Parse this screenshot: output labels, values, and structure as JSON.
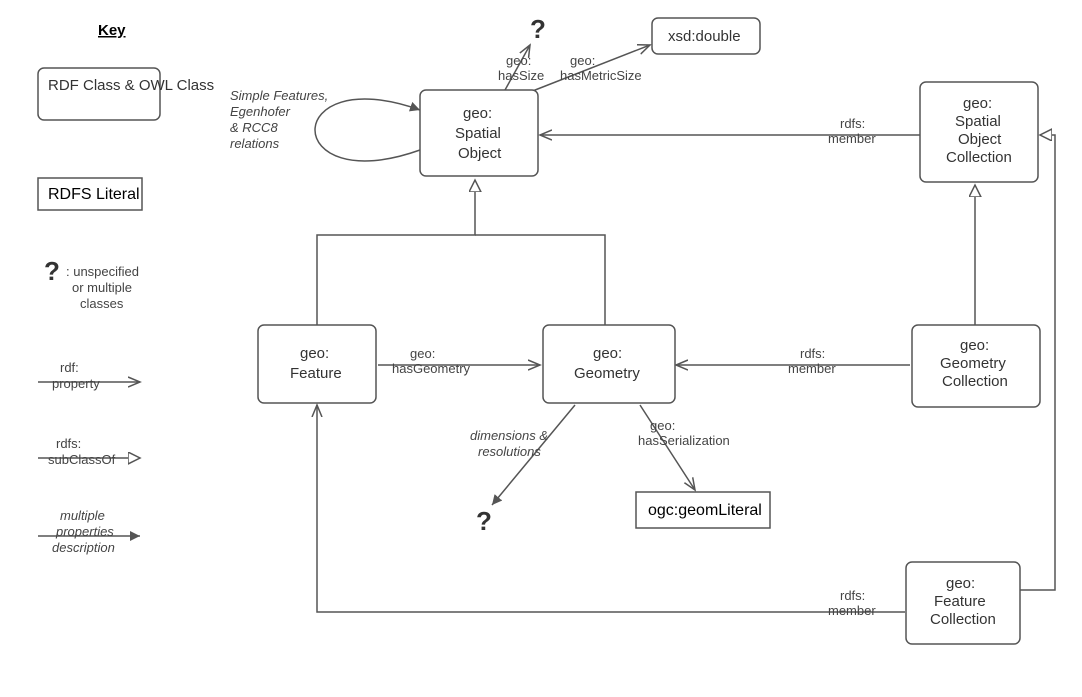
{
  "key": {
    "title": "Key",
    "rdfClass": "RDF Class & OWL Class",
    "rdfsLiteral": "RDFS Literal",
    "qmark": "?",
    "qmarkDesc1": ": unspecified",
    "qmarkDesc2": "or multiple",
    "qmarkDesc3": "classes",
    "rdfProperty": "rdf:\nproperty",
    "rdfsSubClassOf": "rdfs:\nsubClassOf",
    "multi1": "multiple",
    "multi2": "properties",
    "multi3": "description"
  },
  "nodes": {
    "spatialObject": "geo:\nSpatial\nObject",
    "xsdDouble": "xsd:double",
    "spatialObjectCollection": "geo:\nSpatial\nObject\nCollection",
    "feature": "geo:\nFeature",
    "geometry": "geo:\nGeometry",
    "geometryCollection": "geo:\nGeometry\nCollection",
    "geomLiteral": "ogc:geomLiteral",
    "featureCollection": "geo:\nFeature\nCollection",
    "qmark1": "?",
    "qmark2": "?"
  },
  "edges": {
    "hasSize": "geo:\nhasSize",
    "hasMetricSize": "geo:\nhasMetricSize",
    "rdfsMember": "rdfs:\nmember",
    "hasGeometry": "geo:\nhasGeometry",
    "dimRes": "dimensions &\nresolutions",
    "hasSerialization": "geo:\nhasSerialization",
    "simpleFeatures": "Simple Features,\nEgenhofer\n& RCC8\nrelations"
  }
}
